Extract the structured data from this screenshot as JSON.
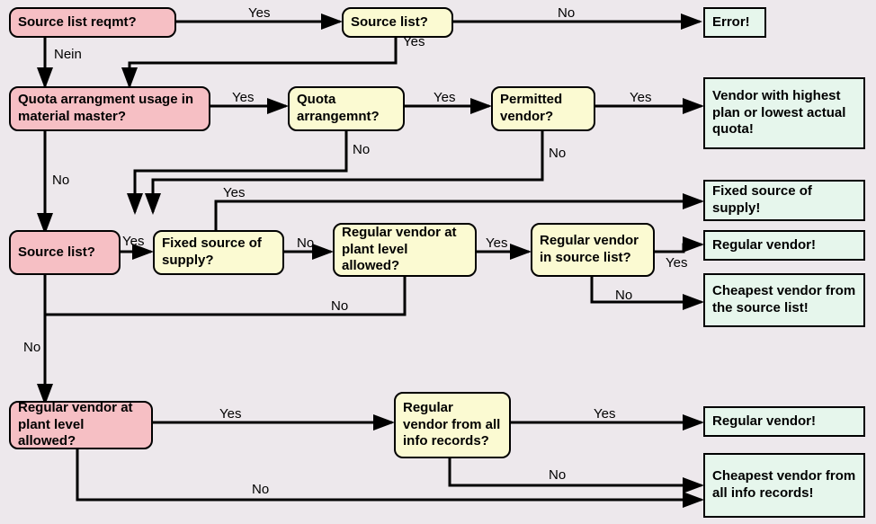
{
  "nodes": {
    "source_list_reqmt": "Source list reqmt?",
    "source_list_top": "Source list?",
    "error": "Error!",
    "quota_usage": "Quota arrangment usage in material master?",
    "quota_arrangement": "Quota arrangemnt?",
    "permitted_vendor": "Permitted vendor?",
    "vendor_highest_plan": "Vendor with highest plan or lowest actual quota!",
    "fixed_source_supply_result": "Fixed source of supply!",
    "source_list_left": "Source list?",
    "fixed_source_supply_q": "Fixed source of supply?",
    "regular_vendor_plant_allowed": "Regular vendor at plant level allowed?",
    "regular_vendor_in_source_list": "Regular vendor in source list?",
    "regular_vendor1": "Regular vendor!",
    "cheapest_vendor_source_list": "Cheapest vendor from the source list!",
    "regular_vendor_plant_allowed2": "Regular vendor at plant level allowed?",
    "regular_vendor_all_info": "Regular vendor from all info records?",
    "regular_vendor2": "Regular vendor!",
    "cheapest_vendor_all_info": "Cheapest vendor from all info records!"
  },
  "labels": {
    "yes": "Yes",
    "no": "No",
    "nein": "Nein"
  }
}
